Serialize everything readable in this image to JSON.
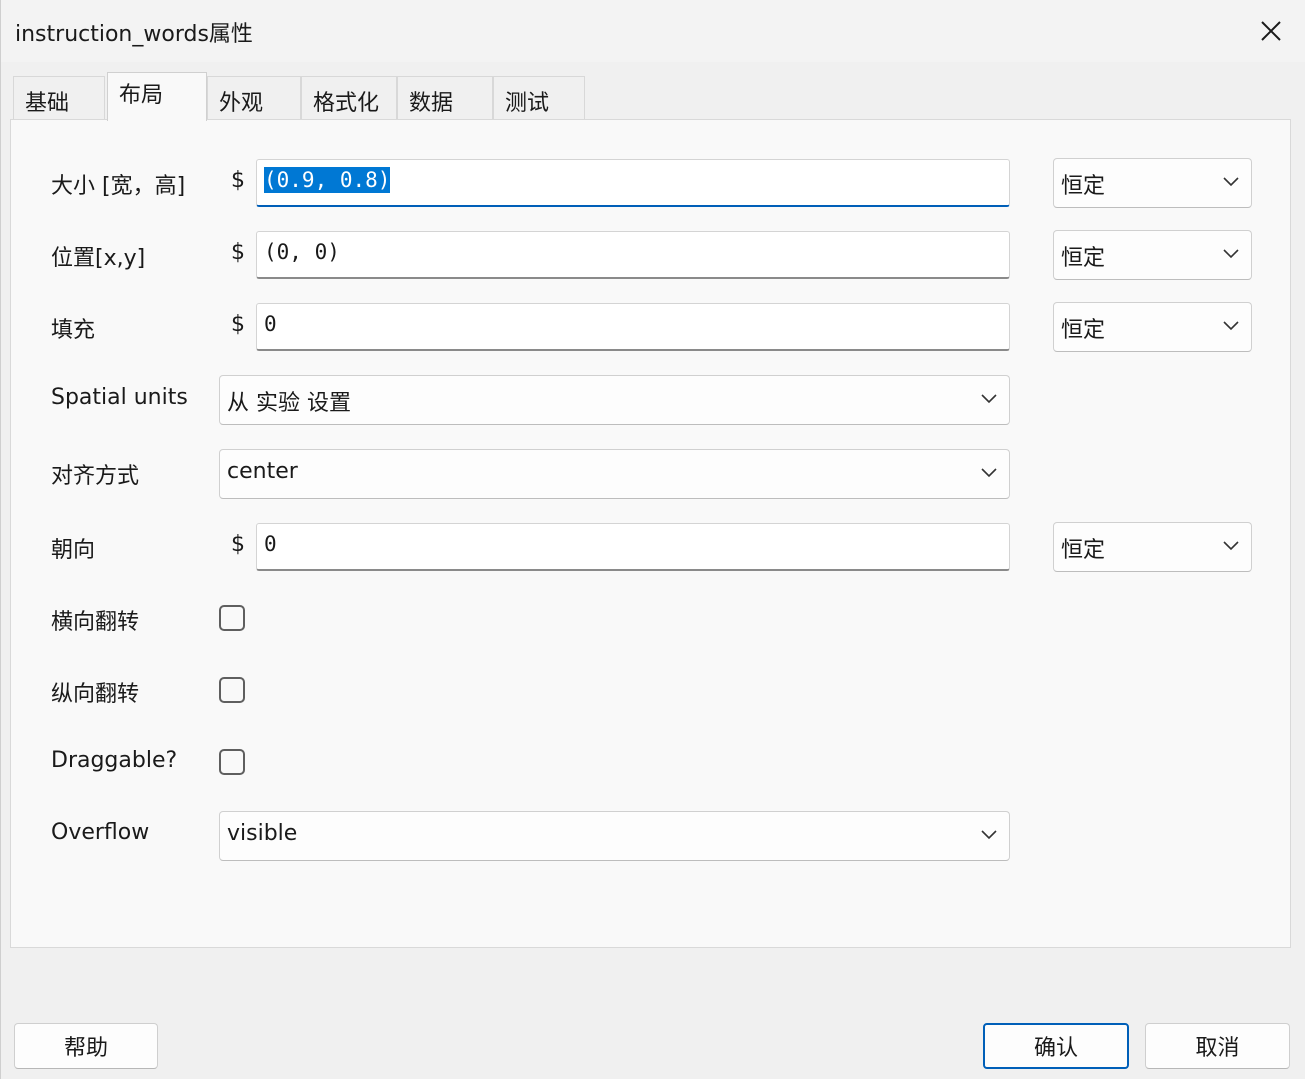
{
  "window": {
    "title": "instruction_words属性"
  },
  "icons": {
    "close": "close-icon",
    "dropdown": "chevron-down-icon"
  },
  "colors": {
    "accent": "#005fb8",
    "selection": "#0078d4"
  },
  "tabs": [
    {
      "label": "基础",
      "active": false
    },
    {
      "label": "布局",
      "active": true
    },
    {
      "label": "外观",
      "active": false
    },
    {
      "label": "格式化",
      "active": false
    },
    {
      "label": "数据",
      "active": false
    },
    {
      "label": "测试",
      "active": false
    }
  ],
  "fields": {
    "size": {
      "label": "大小 [宽，高]",
      "prefix": "$",
      "value": "(0.9, 0.8)",
      "update": "恒定",
      "selected": true
    },
    "position": {
      "label": "位置[x,y]",
      "prefix": "$",
      "value": "(0, 0)",
      "update": "恒定"
    },
    "padding": {
      "label": "填充",
      "prefix": "$",
      "value": "0",
      "update": "恒定"
    },
    "spatial_units": {
      "label": "Spatial units",
      "value": "从 实验 设置"
    },
    "alignment": {
      "label": "对齐方式",
      "value": "center"
    },
    "orientation": {
      "label": "朝向",
      "prefix": "$",
      "value": "0",
      "update": "恒定"
    },
    "flip_horizontal": {
      "label": "横向翻转",
      "checked": false
    },
    "flip_vertical": {
      "label": "纵向翻转",
      "checked": false
    },
    "draggable": {
      "label": "Draggable?",
      "checked": false
    },
    "overflow": {
      "label": "Overflow",
      "value": "visible"
    }
  },
  "footer": {
    "help": "帮助",
    "ok": "确认",
    "cancel": "取消"
  }
}
